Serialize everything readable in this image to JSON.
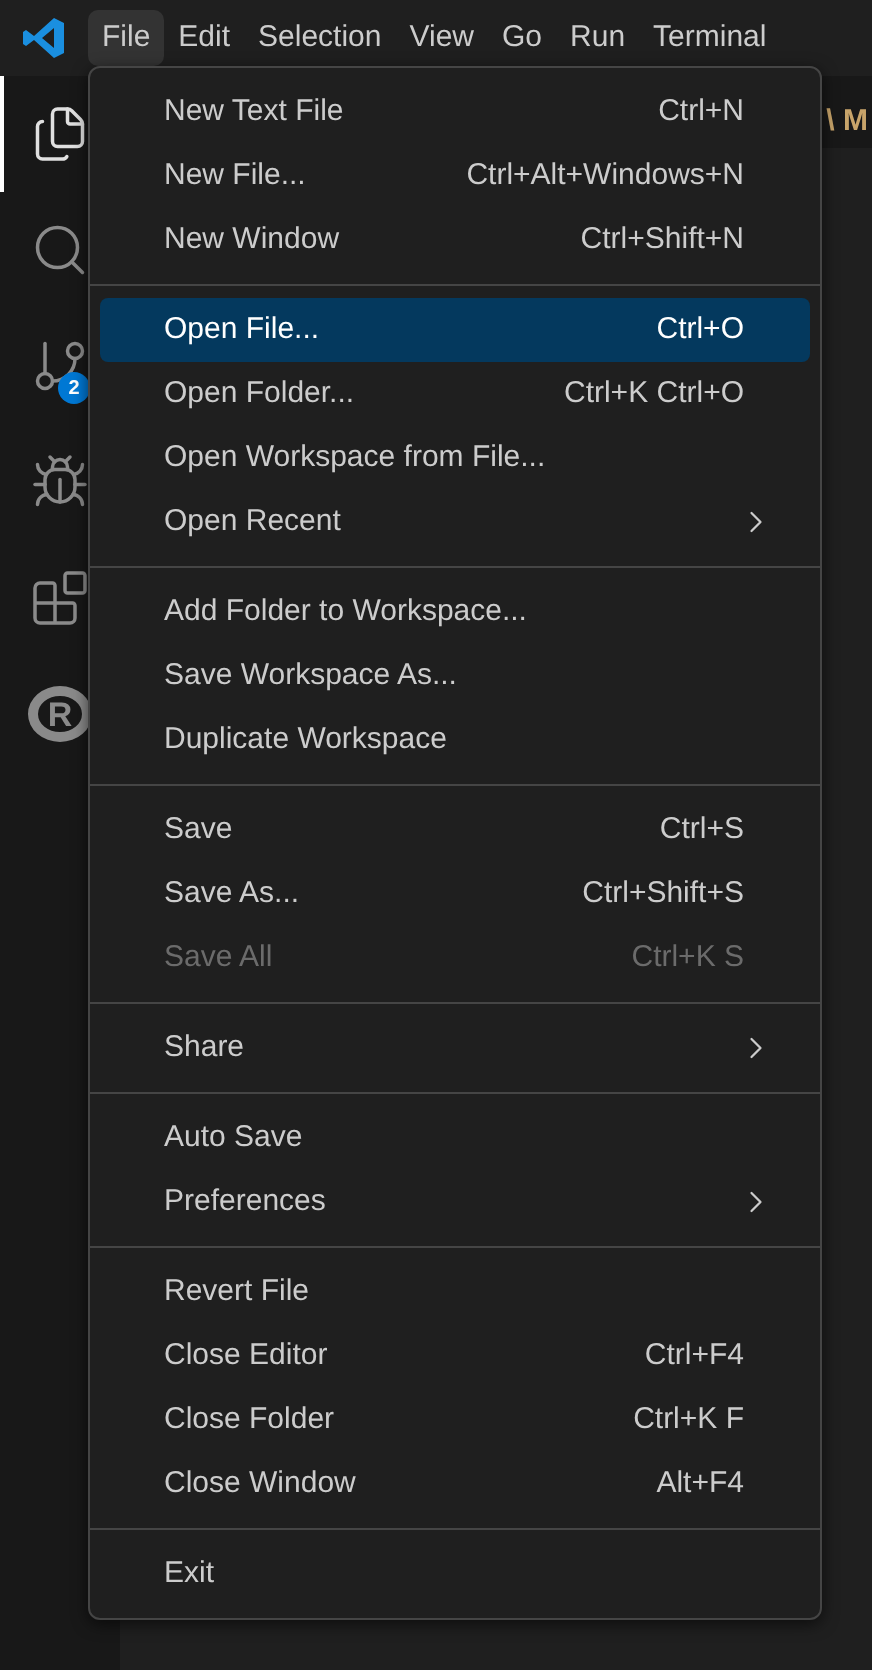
{
  "menubar": [
    {
      "label": "File",
      "selected": true
    },
    {
      "label": "Edit",
      "selected": false
    },
    {
      "label": "Selection",
      "selected": false
    },
    {
      "label": "View",
      "selected": false
    },
    {
      "label": "Go",
      "selected": false
    },
    {
      "label": "Run",
      "selected": false
    },
    {
      "label": "Terminal",
      "selected": false
    }
  ],
  "activity_bar": {
    "items": [
      {
        "kind": "files",
        "selected": true
      },
      {
        "kind": "search",
        "selected": false
      },
      {
        "kind": "source-control",
        "selected": false,
        "badge": "2"
      },
      {
        "kind": "run-debug",
        "selected": false
      },
      {
        "kind": "extensions",
        "selected": false
      },
      {
        "kind": "r",
        "selected": false,
        "letter": "R"
      }
    ]
  },
  "editor": {
    "breadcrumb": "\\ M"
  },
  "file_menu": {
    "groups": [
      [
        {
          "label": "New Text File",
          "shortcut": "Ctrl+N",
          "kind": "item",
          "selected": false,
          "disabled": false
        },
        {
          "label": "New File...",
          "shortcut": "Ctrl+Alt+Windows+N",
          "kind": "item",
          "selected": false,
          "disabled": false
        },
        {
          "label": "New Window",
          "shortcut": "Ctrl+Shift+N",
          "kind": "item",
          "selected": false,
          "disabled": false
        }
      ],
      [
        {
          "label": "Open File...",
          "shortcut": "Ctrl+O",
          "kind": "item",
          "selected": true,
          "disabled": false
        },
        {
          "label": "Open Folder...",
          "shortcut": "Ctrl+K Ctrl+O",
          "kind": "item",
          "selected": false,
          "disabled": false
        },
        {
          "label": "Open Workspace from File...",
          "kind": "item",
          "selected": false,
          "disabled": false
        },
        {
          "label": "Open Recent",
          "kind": "submenu",
          "selected": false,
          "disabled": false
        }
      ],
      [
        {
          "label": "Add Folder to Workspace...",
          "kind": "item",
          "selected": false,
          "disabled": false
        },
        {
          "label": "Save Workspace As...",
          "kind": "item",
          "selected": false,
          "disabled": false
        },
        {
          "label": "Duplicate Workspace",
          "kind": "item",
          "selected": false,
          "disabled": false
        }
      ],
      [
        {
          "label": "Save",
          "shortcut": "Ctrl+S",
          "kind": "item",
          "selected": false,
          "disabled": false
        },
        {
          "label": "Save As...",
          "shortcut": "Ctrl+Shift+S",
          "kind": "item",
          "selected": false,
          "disabled": false
        },
        {
          "label": "Save All",
          "shortcut": "Ctrl+K S",
          "kind": "item",
          "selected": false,
          "disabled": true
        }
      ],
      [
        {
          "label": "Share",
          "kind": "submenu",
          "selected": false,
          "disabled": false
        }
      ],
      [
        {
          "label": "Auto Save",
          "kind": "item",
          "selected": false,
          "disabled": false
        },
        {
          "label": "Preferences",
          "kind": "submenu",
          "selected": false,
          "disabled": false
        }
      ],
      [
        {
          "label": "Revert File",
          "kind": "item",
          "selected": false,
          "disabled": false
        },
        {
          "label": "Close Editor",
          "shortcut": "Ctrl+F4",
          "kind": "item",
          "selected": false,
          "disabled": false
        },
        {
          "label": "Close Folder",
          "shortcut": "Ctrl+K F",
          "kind": "item",
          "selected": false,
          "disabled": false
        },
        {
          "label": "Close Window",
          "shortcut": "Alt+F4",
          "kind": "item",
          "selected": false,
          "disabled": false
        }
      ],
      [
        {
          "label": "Exit",
          "kind": "item",
          "selected": false,
          "disabled": false
        }
      ]
    ]
  }
}
